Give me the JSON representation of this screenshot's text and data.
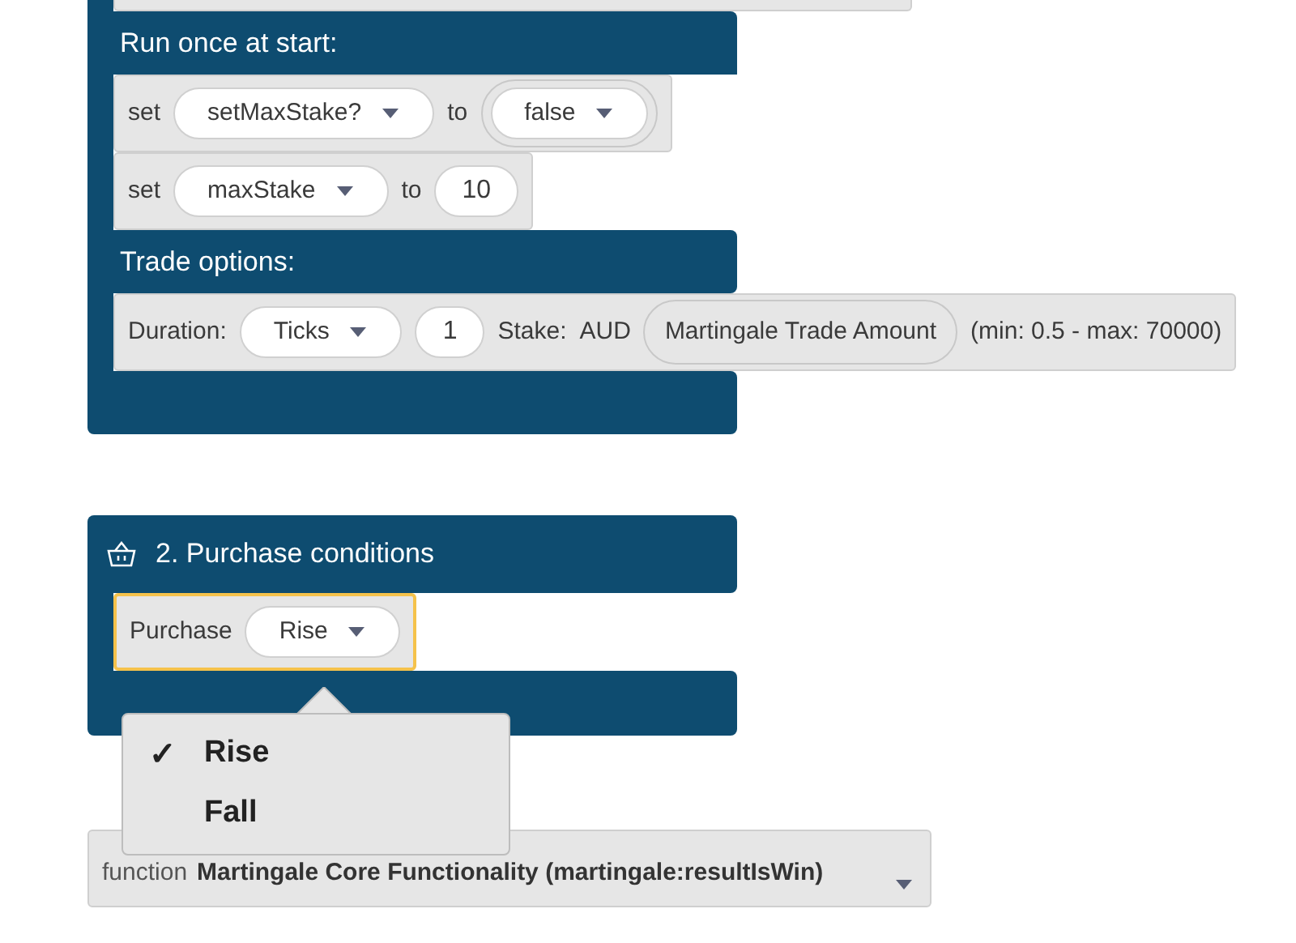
{
  "trade_block": {
    "sections": [
      {
        "heading": "Run once at start:",
        "rows": [
          {
            "selected": false,
            "parts": [
              {
                "kind": "label",
                "text": "set"
              },
              {
                "kind": "dropdown",
                "text": "setMaxStake?"
              },
              {
                "kind": "label",
                "text": "to"
              },
              {
                "kind": "slot",
                "inner": {
                  "kind": "dropdown",
                  "text": "false"
                }
              }
            ]
          },
          {
            "selected": false,
            "parts": [
              {
                "kind": "label",
                "text": "set"
              },
              {
                "kind": "dropdown",
                "text": "maxStake"
              },
              {
                "kind": "label",
                "text": "to"
              },
              {
                "kind": "number",
                "text": "10"
              }
            ]
          }
        ]
      },
      {
        "heading": "Trade options:",
        "rows": [
          {
            "selected": false,
            "parts": [
              {
                "kind": "label",
                "text": "Duration:"
              },
              {
                "kind": "dropdown",
                "text": "Ticks"
              },
              {
                "kind": "number",
                "text": "1"
              },
              {
                "kind": "label",
                "text": "Stake:"
              },
              {
                "kind": "label",
                "text": "AUD"
              },
              {
                "kind": "variable",
                "text": "Martingale Trade Amount"
              },
              {
                "kind": "label",
                "text": "(min: 0.5 - max: 70000)"
              }
            ]
          }
        ]
      }
    ]
  },
  "purchase_block": {
    "title": "2. Purchase conditions",
    "rows": [
      {
        "selected": true,
        "parts": [
          {
            "kind": "label",
            "text": "Purchase"
          },
          {
            "kind": "dropdown",
            "text": "Rise"
          }
        ]
      }
    ]
  },
  "dropdown_menu": {
    "check": "✓",
    "items": [
      {
        "label": "Rise",
        "selected": true
      },
      {
        "label": "Fall",
        "selected": false
      }
    ]
  },
  "function_block": {
    "keyword": "function",
    "name": "Martingale Core Functionality (martingale:resultIsWin)"
  }
}
